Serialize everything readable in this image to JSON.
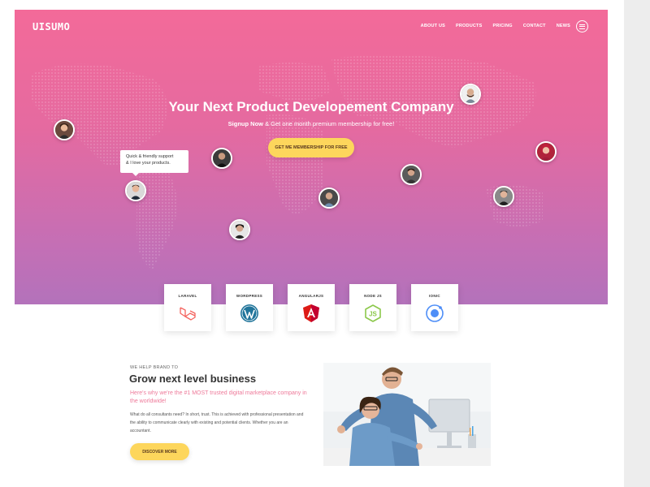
{
  "brand": "UISUMO",
  "nav": {
    "items": [
      "ABOUT US",
      "PRODUCTS",
      "PRICING",
      "CONTACT",
      "NEWS"
    ]
  },
  "hero": {
    "title": "Your Next Product Developement Company",
    "subtitle_bold": "Signup Now",
    "subtitle_rest": " & Get one month premium membership for free!",
    "cta": "GET ME MEMBERSHIP FOR FREE",
    "tooltip_line1": "Quick & friendly support",
    "tooltip_line2": "& I love your products."
  },
  "techs": [
    {
      "label": "LARAVEL",
      "icon": "laravel-icon",
      "color": "#f4645f"
    },
    {
      "label": "WORDPRESS",
      "icon": "wordpress-icon",
      "color": "#21759b"
    },
    {
      "label": "ANGULARJS",
      "icon": "angular-icon",
      "color": "#dd1b16"
    },
    {
      "label": "NODE JS",
      "icon": "nodejs-icon",
      "color": "#8cc84b"
    },
    {
      "label": "IONIC",
      "icon": "ionic-icon",
      "color": "#4e8ef7"
    }
  ],
  "section": {
    "eyebrow": "WE HELP BRAND TO",
    "heading": "Grow next level business",
    "lead": "Here's why we're the #1 MOST trusted digital marketplace company in the worldwide!",
    "body": "What do all consultants need? In short, trust. This is achieved with professional presentation and the ability to communicate clearly with existing and potential clients. Whether you are an accountant.",
    "button": "DISCOVER MORE"
  },
  "colors": {
    "hero_top": "#f36a99",
    "hero_bottom": "#b372bb",
    "button": "#fdd65c",
    "lead_text": "#ee7a9a"
  }
}
